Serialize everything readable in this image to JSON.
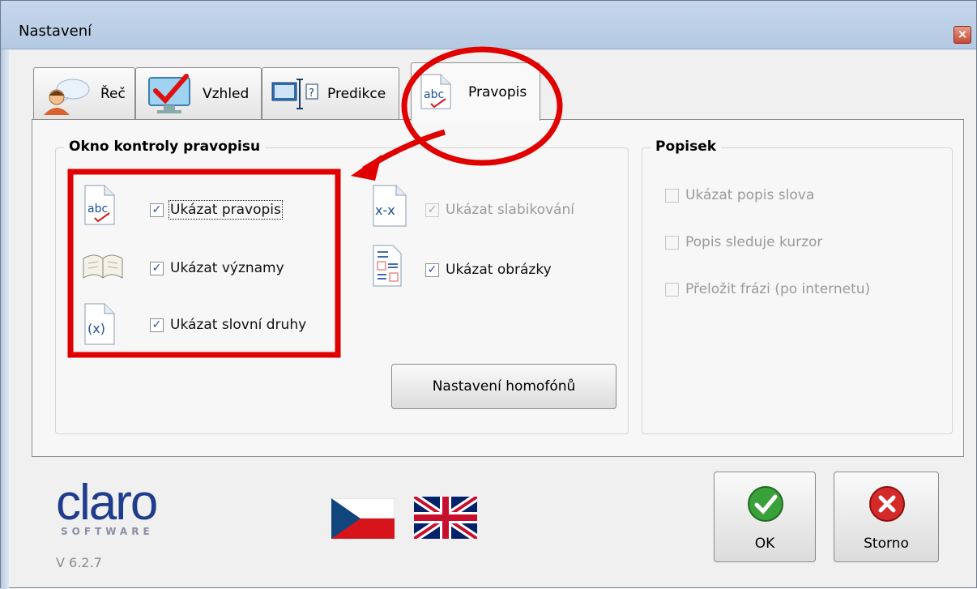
{
  "window": {
    "title": "Nastavení",
    "close_glyph": "×"
  },
  "tabs": [
    {
      "label": "Řeč",
      "icon": "speech-person-icon"
    },
    {
      "label": "Vzhled",
      "icon": "monitor-check-icon"
    },
    {
      "label": "Predikce",
      "icon": "prediction-icon"
    },
    {
      "label": "Pravopis",
      "icon": "abc-spell-icon",
      "active": true
    }
  ],
  "spell_group": {
    "title": "Okno kontroly pravopisu",
    "options": [
      {
        "label": "Ukázat pravopis",
        "checked": true,
        "enabled": true,
        "icon": "abc-spell-icon"
      },
      {
        "label": "Ukázat významy",
        "checked": true,
        "enabled": true,
        "icon": "book-icon"
      },
      {
        "label": "Ukázat slovní druhy",
        "checked": true,
        "enabled": true,
        "icon": "word-class-icon"
      },
      {
        "label": "Ukázat slabikování",
        "checked": true,
        "enabled": false,
        "icon": "syllable-icon"
      },
      {
        "label": "Ukázat obrázky",
        "checked": true,
        "enabled": true,
        "icon": "pictures-icon"
      }
    ],
    "homophones_button": "Nastavení homofónů"
  },
  "tooltip_group": {
    "title": "Popisek",
    "options": [
      {
        "label": "Ukázat popis slova",
        "checked": false,
        "enabled": false
      },
      {
        "label": "Popis sleduje kurzor",
        "checked": false,
        "enabled": false
      },
      {
        "label": "Přeložit frázi (po internetu)",
        "checked": false,
        "enabled": false
      }
    ]
  },
  "icon_text": {
    "abc": "abc",
    "syllable": "x-x",
    "word_class": "(x)",
    "check": "✓",
    "predict_q": "?"
  },
  "footer": {
    "logo_text": "claro",
    "logo_sub": "SOFTWARE",
    "version": "V 6.2.7",
    "languages": [
      {
        "name": "czech-flag-icon"
      },
      {
        "name": "uk-flag-icon"
      }
    ],
    "ok_label": "OK",
    "cancel_label": "Storno"
  },
  "colors": {
    "annotation_red": "#e00000",
    "ok_green": "#3aa13a",
    "cancel_red": "#d42a2a",
    "logo_blue": "#1f3d8c"
  }
}
